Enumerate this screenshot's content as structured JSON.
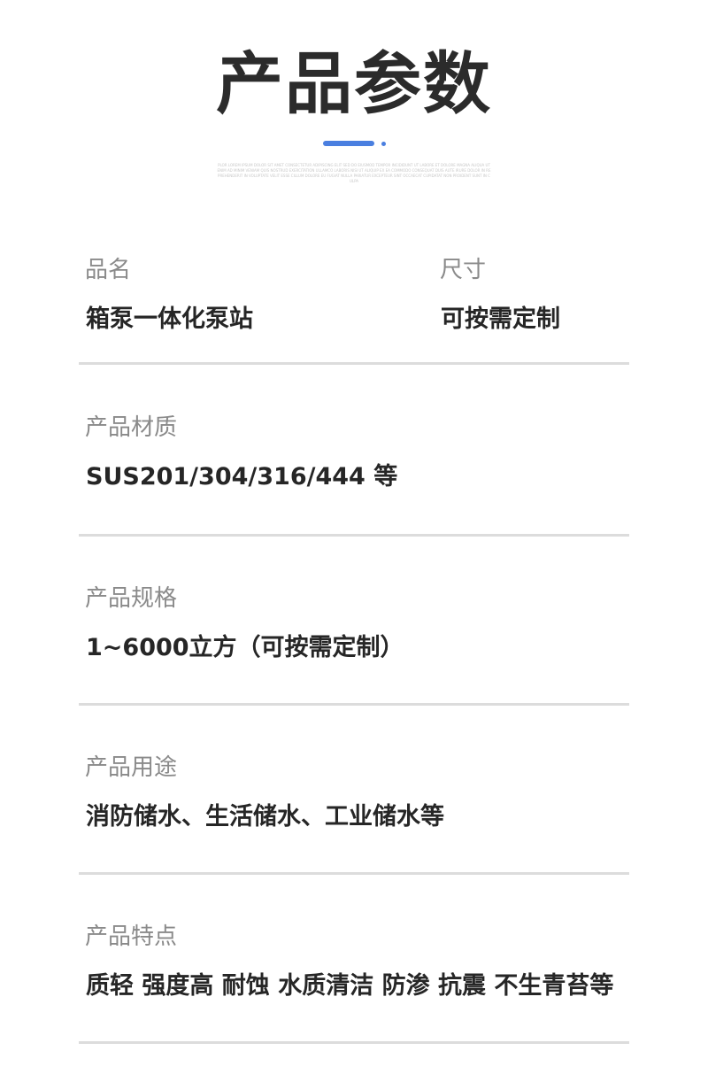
{
  "header": {
    "title": "产品参数",
    "fine_print": "PLOR LOREM IPSUM DOLOR SIT AMET CONSECTETUR ADIPISCING ELIT SED DO EIUSMOD TEMPOR INCIDIDUNT UT LABORE ET DOLORE MAGNA ALIQUA UT ENIM AD MINIM VENIAM QUIS NOSTRUD EXERCITATION ULLAMCO LABORIS NISI UT ALIQUIP EX EA COMMODO CONSEQUAT DUIS AUTE IRURE DOLOR IN REPREHENDERIT IN VOLUPTATE VELIT ESSE CILLUM DOLORE EU FUGIAT NULLA PARIATUR EXCEPTEUR SINT OCCAECAT CUPIDATAT NON PROIDENT SUNT IN CULPA"
  },
  "colors": {
    "accent": "#4a7fe0",
    "divider": "#dcdcdc",
    "label": "#8a8a8a",
    "value": "#262626"
  },
  "params": {
    "name": {
      "label": "品名",
      "value": "箱泵一体化泵站"
    },
    "size": {
      "label": "尺寸",
      "value": "可按需定制"
    },
    "material": {
      "label": "产品材质",
      "value": "SUS201/304/316/444 等"
    },
    "spec": {
      "label": "产品规格",
      "value": "1~6000立方（可按需定制）"
    },
    "usage": {
      "label": "产品用途",
      "value": "消防储水、生活储水、工业储水等"
    },
    "features": {
      "label": "产品特点",
      "value": "质轻 强度高 耐蚀 水质清洁 防渗 抗震 不生青苔等"
    }
  }
}
